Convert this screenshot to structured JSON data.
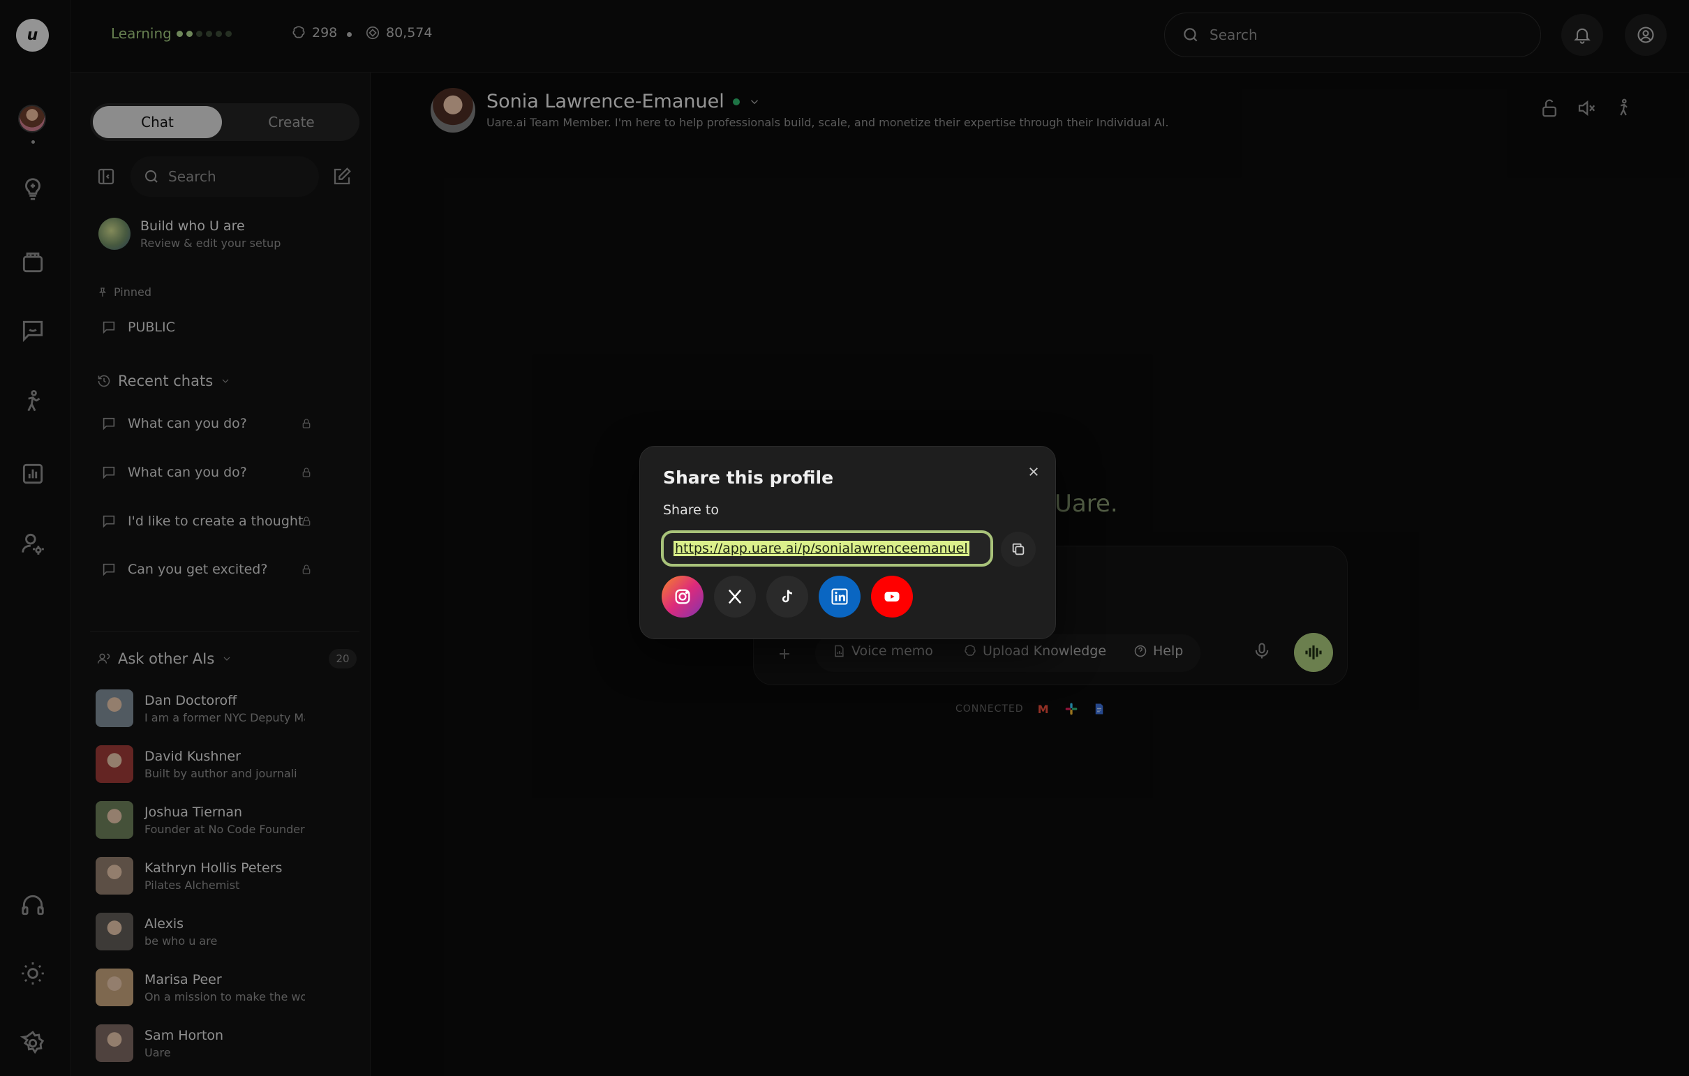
{
  "topbar": {
    "learning_label": "Learning",
    "learning_dots_on": 2,
    "learning_dots_total": 6,
    "stat_knowledge": "298",
    "stat_points": "80,574",
    "search_placeholder": "Search"
  },
  "sidebar": {
    "tab_chat": "Chat",
    "tab_create": "Create",
    "search_placeholder": "Search",
    "build_title": "Build who U are",
    "build_subtitle": "Review & edit your setup",
    "pinned_label": "Pinned",
    "pinned_items": [
      "PUBLIC"
    ],
    "recent_label": "Recent chats",
    "recent_chats": [
      "What can you do?",
      "What can you do?",
      "I'd like to create a thought",
      "Can you get excited?"
    ],
    "ask_label": "Ask other AIs",
    "ask_count": "20",
    "people": [
      {
        "name": "Dan Doctoroff",
        "desc": "I am a former NYC Deputy May",
        "color": "#7d8a96"
      },
      {
        "name": "David Kushner",
        "desc": "Built by author and journali",
        "color": "#9a3a36"
      },
      {
        "name": "Joshua Tiernan",
        "desc": "Founder at No Code Founders",
        "color": "#6b7d58"
      },
      {
        "name": "Kathryn Hollis Peters",
        "desc": "Pilates Alchemist",
        "color": "#8e7a6a"
      },
      {
        "name": "Alexis",
        "desc": "be who u are",
        "color": "#5e5a55"
      },
      {
        "name": "Marisa Peer",
        "desc": "On a mission to make the wor",
        "color": "#c2a07a"
      },
      {
        "name": "Sam Horton",
        "desc": "Uare",
        "color": "#7a6660"
      }
    ]
  },
  "profile": {
    "name": "Sonia Lawrence-Emanuel",
    "description": "Uare.ai Team Member. I'm here to help professionals build, scale, and monetize their expertise through their Individual AI."
  },
  "main": {
    "welcome_fragment": "Uare.",
    "composer": {
      "voice_memo": "Voice memo",
      "upload_knowledge": "Upload Knowledge",
      "help": "Help"
    },
    "connected_label": "CONNECTED"
  },
  "modal": {
    "title": "Share this profile",
    "share_to": "Share to",
    "url": "https://app.uare.ai/p/sonialawrenceemanuel",
    "socials": [
      {
        "name": "instagram",
        "color": "#d6336c"
      },
      {
        "name": "x",
        "color": "#2a2a2a"
      },
      {
        "name": "tiktok",
        "color": "#2a2a2a"
      },
      {
        "name": "linkedin",
        "color": "#0a66c2"
      },
      {
        "name": "youtube",
        "color": "#ff0000"
      }
    ]
  }
}
